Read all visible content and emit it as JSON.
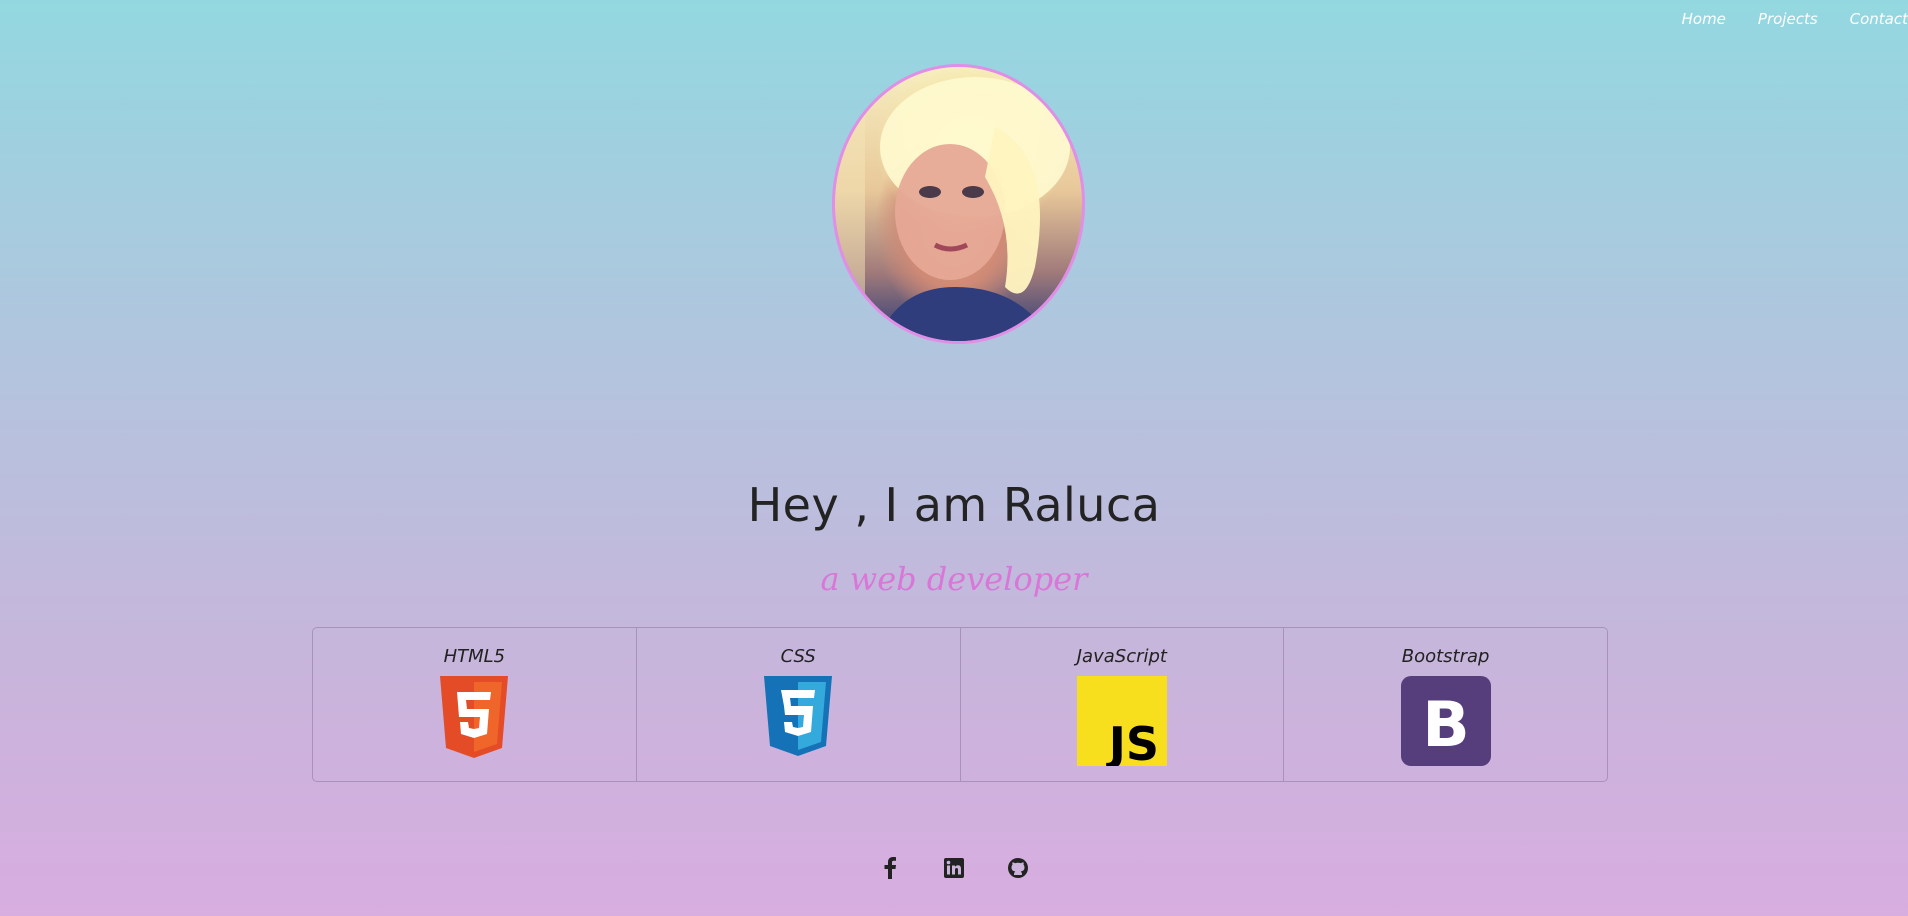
{
  "nav": {
    "items": [
      {
        "label": "Home"
      },
      {
        "label": "Projects"
      },
      {
        "label": "Contact"
      }
    ]
  },
  "hero": {
    "title": "Hey , I am Raluca",
    "subtitle": "a web developer"
  },
  "skills": [
    {
      "name": "HTML5",
      "icon": "html5-icon"
    },
    {
      "name": "CSS",
      "icon": "css3-icon"
    },
    {
      "name": "JavaScript",
      "icon": "javascript-icon"
    },
    {
      "name": "Bootstrap",
      "icon": "bootstrap-icon"
    }
  ],
  "social": [
    {
      "icon": "facebook-icon"
    },
    {
      "icon": "linkedin-icon"
    },
    {
      "icon": "github-icon"
    }
  ],
  "colors": {
    "accent": "#d977d8",
    "gradient_top": "#93d8e0",
    "gradient_bottom": "#d8ade0"
  }
}
